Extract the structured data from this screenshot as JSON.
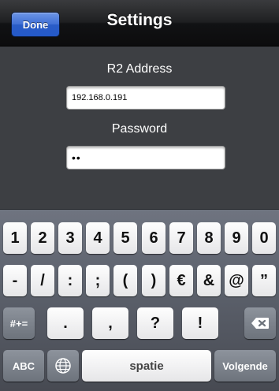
{
  "navbar": {
    "title": "Settings",
    "done_label": "Done"
  },
  "form": {
    "address_label": "R2 Address",
    "address_value": "192.168.0.191",
    "password_label": "Password",
    "password_value": "••"
  },
  "keyboard": {
    "row1": [
      "1",
      "2",
      "3",
      "4",
      "5",
      "6",
      "7",
      "8",
      "9",
      "0"
    ],
    "row2": [
      "-",
      "/",
      ":",
      ";",
      "(",
      ")",
      "€",
      "&",
      "@",
      "”"
    ],
    "row3": {
      "shift_label": "#+=",
      "keys": [
        ".",
        ",",
        "?",
        "!",
        "’"
      ],
      "delete_icon": "backspace-icon"
    },
    "row4": {
      "abc_label": "ABC",
      "globe_icon": "globe-icon",
      "space_label": "spatie",
      "return_label": "Volgende"
    }
  },
  "colors": {
    "done_button": "#3f6fd5",
    "background": "#3d3f43"
  }
}
